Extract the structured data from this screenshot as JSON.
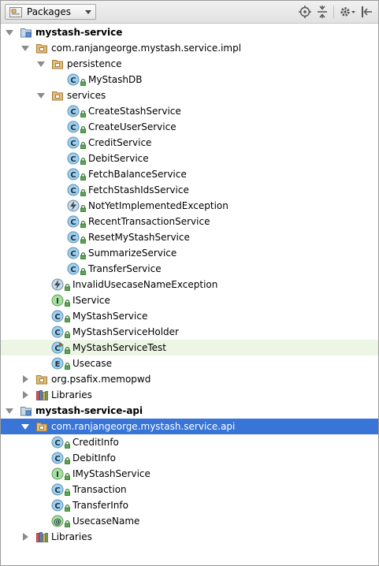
{
  "toolbar": {
    "view_label": "Packages",
    "icons": [
      "scroll-from-source-icon",
      "collapse-all-icon",
      "settings-icon",
      "hide-icon"
    ]
  },
  "tree": [
    {
      "label": "mystash-service",
      "kind": "module",
      "expanded": true,
      "bold": true
    },
    {
      "label": "com.ranjangeorge.mystash.service.impl",
      "kind": "package",
      "expanded": true
    },
    {
      "label": "persistence",
      "kind": "package",
      "expanded": true
    },
    {
      "label": "MyStashDB",
      "kind": "class"
    },
    {
      "label": "services",
      "kind": "package",
      "expanded": true
    },
    {
      "label": "CreateStashService",
      "kind": "class"
    },
    {
      "label": "CreateUserService",
      "kind": "class"
    },
    {
      "label": "CreditService",
      "kind": "class"
    },
    {
      "label": "DebitService",
      "kind": "class"
    },
    {
      "label": "FetchBalanceService",
      "kind": "class"
    },
    {
      "label": "FetchStashIdsService",
      "kind": "class"
    },
    {
      "label": "NotYetImplementedException",
      "kind": "exception"
    },
    {
      "label": "RecentTransactionService",
      "kind": "class"
    },
    {
      "label": "ResetMyStashService",
      "kind": "class"
    },
    {
      "label": "SummarizeService",
      "kind": "class"
    },
    {
      "label": "TransferService",
      "kind": "class"
    },
    {
      "label": "InvalidUsecaseNameException",
      "kind": "exception"
    },
    {
      "label": "IService",
      "kind": "interface"
    },
    {
      "label": "MyStashService",
      "kind": "class"
    },
    {
      "label": "MyStashServiceHolder",
      "kind": "class"
    },
    {
      "label": "MyStashServiceTest",
      "kind": "test",
      "highlighted": true
    },
    {
      "label": "Usecase",
      "kind": "enum"
    },
    {
      "label": "org.psafix.memopwd",
      "kind": "package",
      "expanded": false
    },
    {
      "label": "Libraries",
      "kind": "libraries",
      "expanded": false
    },
    {
      "label": "mystash-service-api",
      "kind": "module",
      "expanded": true,
      "bold": true
    },
    {
      "label": "com.ranjangeorge.mystash.service.api",
      "kind": "package",
      "expanded": true,
      "selected": true
    },
    {
      "label": "CreditInfo",
      "kind": "class"
    },
    {
      "label": "DebitInfo",
      "kind": "class"
    },
    {
      "label": "IMyStashService",
      "kind": "interface"
    },
    {
      "label": "Transaction",
      "kind": "class"
    },
    {
      "label": "TransferInfo",
      "kind": "class"
    },
    {
      "label": "UsecaseName",
      "kind": "annotation"
    },
    {
      "label": "Libraries",
      "kind": "libraries",
      "expanded": false
    }
  ],
  "colors": {
    "selection": "#3875d7",
    "highlight_row": "#edf6e5",
    "class_icon": "#9fd0ee",
    "interface_icon": "#a6e1a0",
    "enum_icon": "#9fd0ee",
    "annotation_icon": "#a6e1a0",
    "package_folder": "#e3bd7a"
  }
}
